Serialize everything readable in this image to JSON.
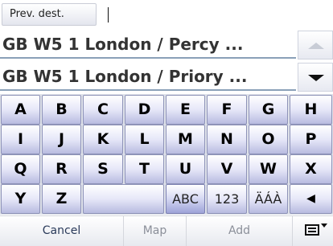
{
  "input": {
    "label": "Prev. dest.",
    "value": ""
  },
  "results": [
    "GB W5 1 London / Percy ...",
    "GB W5 1 London / Priory ..."
  ],
  "keyboard": {
    "row1": [
      "A",
      "B",
      "C",
      "D",
      "E",
      "F",
      "G",
      "H"
    ],
    "row2": [
      "I",
      "J",
      "K",
      "L",
      "M",
      "N",
      "O",
      "P"
    ],
    "row3": [
      "Q",
      "R",
      "S",
      "T",
      "U",
      "V",
      "W",
      "X"
    ],
    "row4": {
      "keys": [
        "Y",
        "Z"
      ],
      "modes": [
        "ABC",
        "123",
        "ÄÁÀ"
      ],
      "active_mode": "ABC",
      "backspace": "◀"
    }
  },
  "bottom_bar": {
    "cancel": "Cancel",
    "map": "Map",
    "add": "Add"
  },
  "icons": {
    "scroll_up": "triangle-up-icon",
    "scroll_down": "triangle-down-icon",
    "backspace": "backspace-arrow-icon",
    "keyboard_toggle": "keyboard-icon"
  }
}
